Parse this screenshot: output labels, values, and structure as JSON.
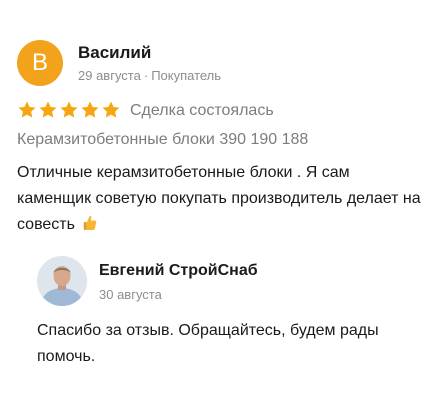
{
  "review": {
    "avatar_letter": "В",
    "author": "Василий",
    "date": "29 августа",
    "separator": "·",
    "role": "Покупатель",
    "rating": 5,
    "rating_max": 5,
    "status": "Сделка состоялась",
    "product": "Керамзитобетонные блоки 390 190 188",
    "text": "Отличные керамзитобетонные блоки . Я сам каменщик советую покупать производитель делает на совесть",
    "emoji": "thumbs-up-icon"
  },
  "reply": {
    "author": "Евгений СтройСнаб",
    "date": "30 августа",
    "text": "Спасибо за отзыв. Обращайтесь, будем рады помочь."
  },
  "colors": {
    "avatar_bg": "#f3a21c",
    "star": "#f6a611",
    "muted_text": "#8d8d8d"
  }
}
